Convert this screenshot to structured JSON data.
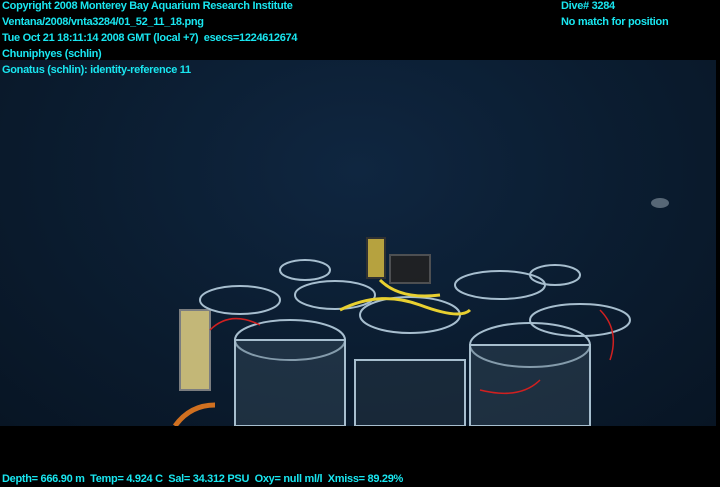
{
  "overlay": {
    "copyright": "Copyright 2008 Monterey Bay Aquarium Research Institute",
    "file_path": "Ventana/2008/vnta3284/01_52_11_18.png",
    "timestamp": "Tue Oct 21 18:11:14 2008 GMT (local +7)  esecs=1224612674",
    "annotation_1": "Chuniphyes (schlin)",
    "annotation_2": "Gonatus (schlin): identity-reference 11",
    "dive": "Dive# 3284",
    "position": "No match for position",
    "sensors": "Depth= 666.90 m  Temp= 4.924 C  Sal= 34.312 PSU  Oxy= null ml/l  Xmiss= 89.29%"
  }
}
